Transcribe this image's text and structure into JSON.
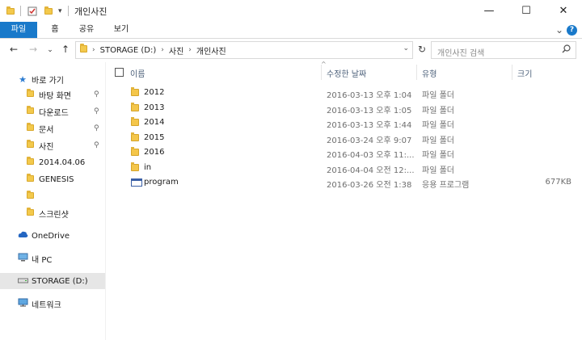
{
  "window": {
    "title": "개인사진",
    "minimize": "—",
    "maximize": "☐",
    "close": "✕"
  },
  "quick_access": {
    "dropdown": "▾"
  },
  "ribbon": {
    "tabs": [
      "파일",
      "홈",
      "공유",
      "보기"
    ],
    "expand": "⌄",
    "help": "?"
  },
  "nav": {
    "back": "←",
    "forward": "→",
    "recent": "⌄",
    "up": "↑",
    "breadcrumb": [
      "STORAGE (D:)",
      "사진",
      "개인사진"
    ],
    "crumb_sep": "›",
    "address_dropdown": "⌄",
    "refresh": "↻",
    "search_placeholder": "개인사진 검색",
    "search_icon": "🔍︎"
  },
  "sidebar": {
    "items": [
      {
        "label": "바로 가기",
        "icon": "star-icon",
        "pinned": false,
        "level": 0
      },
      {
        "label": "바탕 화면",
        "icon": "desktop-folder-icon",
        "pinned": true,
        "level": 1
      },
      {
        "label": "다운로드",
        "icon": "download-folder-icon",
        "pinned": true,
        "level": 1
      },
      {
        "label": "문서",
        "icon": "documents-folder-icon",
        "pinned": true,
        "level": 1
      },
      {
        "label": "사진",
        "icon": "pictures-folder-icon",
        "pinned": true,
        "level": 1
      },
      {
        "label": "2014.04.06",
        "icon": "folder-icon",
        "pinned": false,
        "level": 1
      },
      {
        "label": "GENESIS",
        "icon": "folder-icon",
        "pinned": false,
        "level": 1
      },
      {
        "label": "",
        "icon": "folder-icon",
        "pinned": false,
        "level": 1
      },
      {
        "label": "스크린샷",
        "icon": "folder-icon",
        "pinned": false,
        "level": 1
      },
      {
        "label": "OneDrive",
        "icon": "cloud-icon",
        "pinned": false,
        "level": 0
      },
      {
        "label": "내 PC",
        "icon": "computer-icon",
        "pinned": false,
        "level": 0
      },
      {
        "label": "STORAGE (D:)",
        "icon": "drive-icon",
        "pinned": false,
        "level": 0,
        "selected": true
      },
      {
        "label": "네트워크",
        "icon": "network-icon",
        "pinned": false,
        "level": 0
      }
    ],
    "pin_glyph": "📌︎"
  },
  "columns": {
    "name": "이름",
    "date": "수정한 날짜",
    "type": "유형",
    "size": "크기",
    "sort_indicator": "^"
  },
  "files": [
    {
      "name": "2012",
      "date": "2016-03-13 오후 1:04",
      "type": "파일 폴더",
      "size": "",
      "icon": "folder-icon"
    },
    {
      "name": "2013",
      "date": "2016-03-13 오후 1:05",
      "type": "파일 폴더",
      "size": "",
      "icon": "folder-icon"
    },
    {
      "name": "2014",
      "date": "2016-03-13 오후 1:44",
      "type": "파일 폴더",
      "size": "",
      "icon": "folder-icon"
    },
    {
      "name": "2015",
      "date": "2016-03-24 오후 9:07",
      "type": "파일 폴더",
      "size": "",
      "icon": "folder-icon"
    },
    {
      "name": "2016",
      "date": "2016-04-03 오후 11:...",
      "type": "파일 폴더",
      "size": "",
      "icon": "folder-icon"
    },
    {
      "name": "in",
      "date": "2016-04-04 오전 12:...",
      "type": "파일 폴더",
      "size": "",
      "icon": "folder-icon"
    },
    {
      "name": "program",
      "date": "2016-03-26 오전 1:38",
      "type": "응용 프로그램",
      "size": "677KB",
      "icon": "application-icon"
    }
  ],
  "colors": {
    "file_tab": "#1979ca",
    "folder": "#f4c64a",
    "header_text": "#4c607a",
    "selected_bg": "#e6e6e6"
  }
}
